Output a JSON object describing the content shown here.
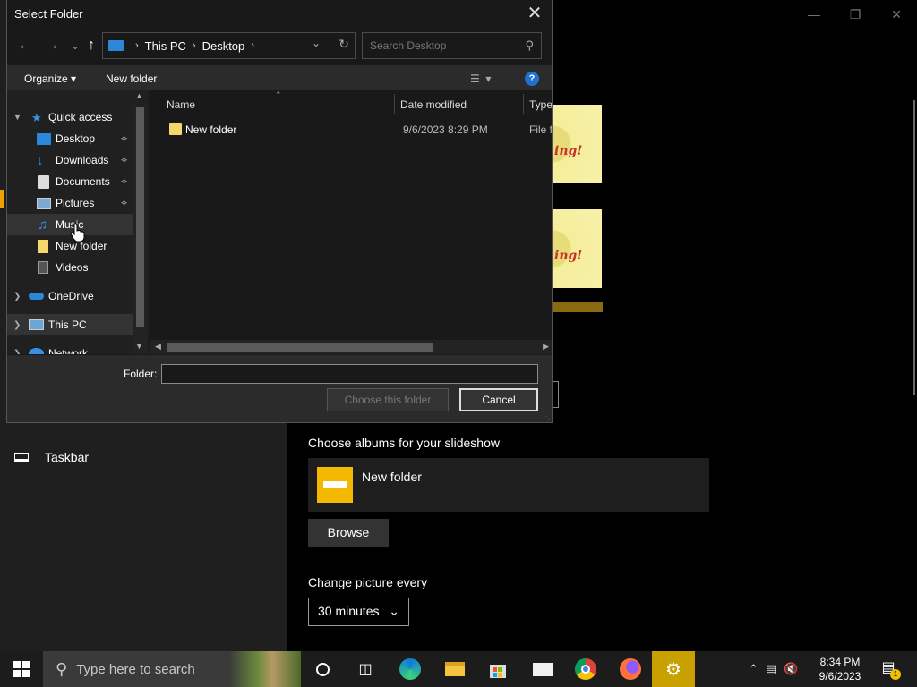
{
  "dialog": {
    "title": "Select Folder",
    "breadcrumb": [
      "This PC",
      "Desktop"
    ],
    "search_placeholder": "Search Desktop",
    "toolbar": {
      "organize": "Organize",
      "new_folder": "New folder"
    },
    "nav_items": [
      {
        "label": "Quick access",
        "icon": "star-icon"
      },
      {
        "label": "Desktop",
        "icon": "desktop-icon",
        "pinned": true
      },
      {
        "label": "Downloads",
        "icon": "download-icon",
        "pinned": true
      },
      {
        "label": "Documents",
        "icon": "document-icon",
        "pinned": true
      },
      {
        "label": "Pictures",
        "icon": "pictures-icon",
        "pinned": true
      },
      {
        "label": "Music",
        "icon": "music-icon"
      },
      {
        "label": "New folder",
        "icon": "folder-icon"
      },
      {
        "label": "Videos",
        "icon": "video-icon"
      },
      {
        "label": "OneDrive",
        "icon": "cloud-icon"
      },
      {
        "label": "This PC",
        "icon": "computer-icon"
      },
      {
        "label": "Network",
        "icon": "network-icon"
      }
    ],
    "columns": {
      "name": "Name",
      "date": "Date modified",
      "type": "Type"
    },
    "files": [
      {
        "name": "New folder",
        "date": "9/6/2023 8:29 PM",
        "type": "File folder"
      }
    ],
    "folder_label": "Folder:",
    "folder_value": "",
    "choose_button": "Choose this folder",
    "cancel_button": "Cancel"
  },
  "settings": {
    "taskbar_nav": "Taskbar",
    "albums_title": "Choose albums for your slideshow",
    "album_name": "New folder",
    "browse_button": "Browse",
    "interval_title": "Change picture every",
    "interval_value": "30 minutes",
    "thumb_text": "ing!"
  },
  "taskbar": {
    "search_placeholder": "Type here to search",
    "time": "8:34 PM",
    "date": "9/6/2023",
    "notification_count": "1"
  },
  "colors": {
    "accent": "#f0a000",
    "folder": "#f5d76e",
    "link_blue": "#1f72d0"
  }
}
